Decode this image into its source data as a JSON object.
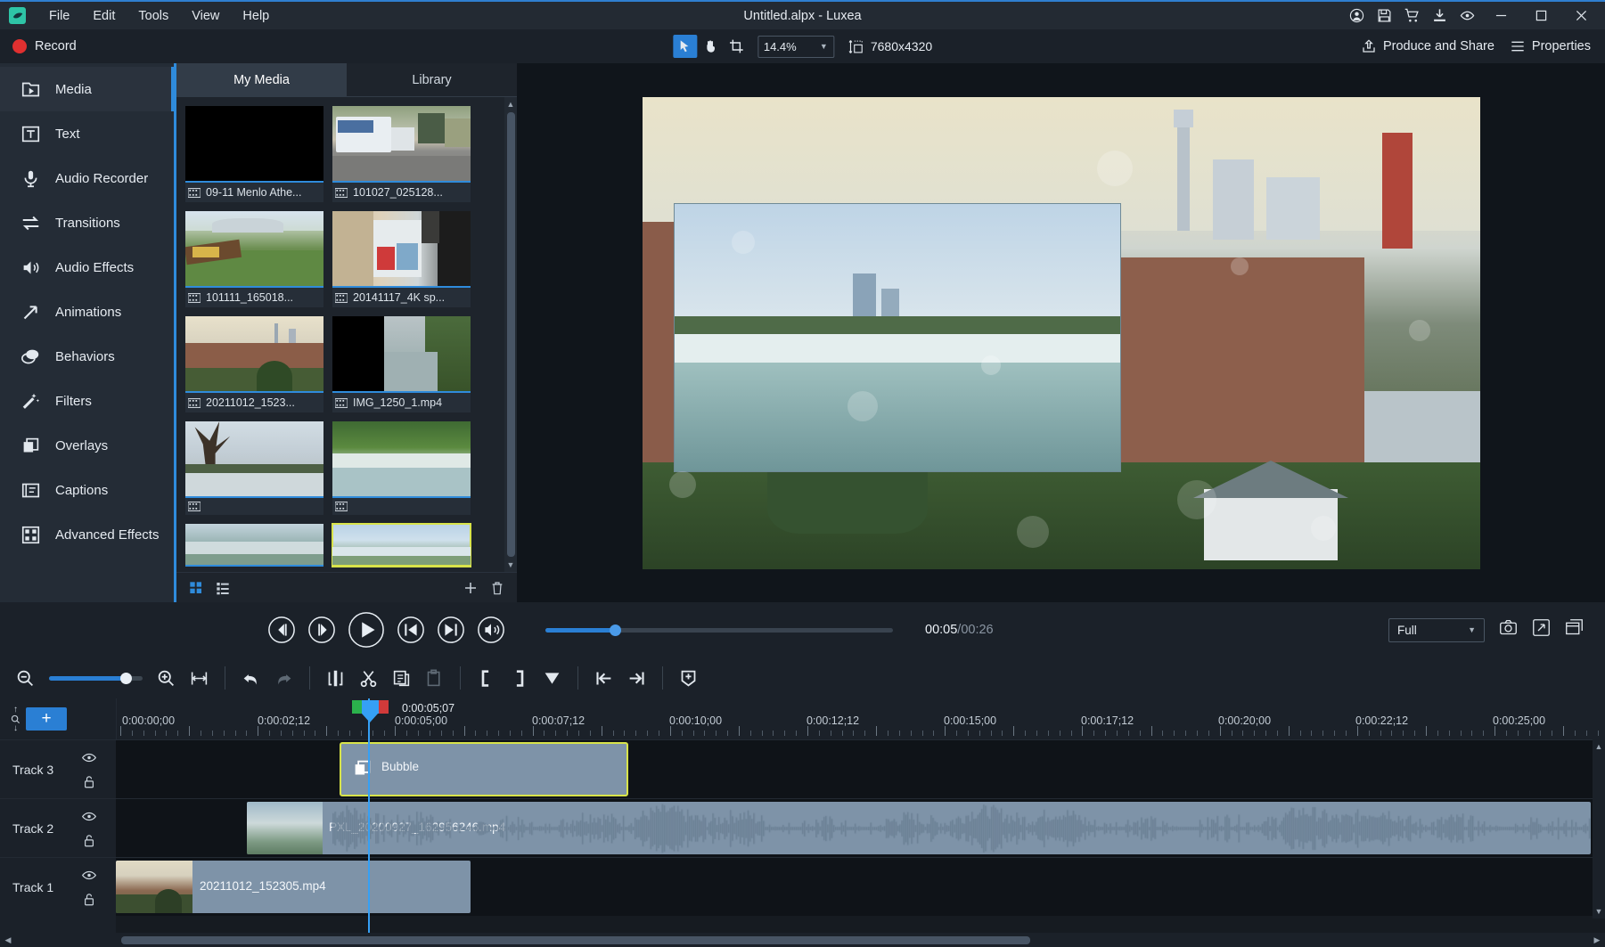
{
  "window": {
    "title": "Untitled.alpx - Luxea",
    "menus": [
      "File",
      "Edit",
      "Tools",
      "View",
      "Help"
    ],
    "titlebar_icons": [
      "account-icon",
      "save-icon",
      "cart-icon",
      "download-icon",
      "eye-icon"
    ],
    "controls": [
      "minimize",
      "maximize",
      "close"
    ]
  },
  "toolbar": {
    "record_label": "Record",
    "tools": [
      {
        "name": "select-tool",
        "active": true
      },
      {
        "name": "pan-tool",
        "active": false
      },
      {
        "name": "crop-tool",
        "active": false
      }
    ],
    "zoom_value": "14.4%",
    "dimensions": "7680x4320",
    "produce_label": "Produce and Share",
    "properties_label": "Properties"
  },
  "sidebar": {
    "items": [
      {
        "label": "Media",
        "icon": "media-folder-icon",
        "active": true
      },
      {
        "label": "Text",
        "icon": "text-icon",
        "active": false
      },
      {
        "label": "Audio Recorder",
        "icon": "microphone-icon",
        "active": false
      },
      {
        "label": "Transitions",
        "icon": "transitions-icon",
        "active": false
      },
      {
        "label": "Audio Effects",
        "icon": "speaker-icon",
        "active": false
      },
      {
        "label": "Animations",
        "icon": "arrow-up-right-icon",
        "active": false
      },
      {
        "label": "Behaviors",
        "icon": "behaviors-icon",
        "active": false
      },
      {
        "label": "Filters",
        "icon": "magic-wand-icon",
        "active": false
      },
      {
        "label": "Overlays",
        "icon": "layers-icon",
        "active": false
      },
      {
        "label": "Captions",
        "icon": "captions-icon",
        "active": false
      },
      {
        "label": "Advanced Effects",
        "icon": "advanced-effects-icon",
        "active": false
      }
    ]
  },
  "media_panel": {
    "tabs": [
      {
        "label": "My Media",
        "active": true
      },
      {
        "label": "Library",
        "active": false
      }
    ],
    "items": [
      {
        "label": "09-11 Menlo Athe...",
        "selected": false
      },
      {
        "label": "101027_025128...",
        "selected": false
      },
      {
        "label": "101111_165018...",
        "selected": false
      },
      {
        "label": "20141117_4K sp...",
        "selected": false
      },
      {
        "label": "20211012_1523...",
        "selected": false
      },
      {
        "label": "IMG_1250_1.mp4",
        "selected": false
      },
      {
        "label": "",
        "selected": false
      },
      {
        "label": "",
        "selected": true
      }
    ],
    "footer_icons": [
      "grid-view-icon",
      "list-view-icon",
      "add-media-icon",
      "delete-media-icon"
    ]
  },
  "playback": {
    "buttons": [
      "step-back-icon",
      "step-forward-icon",
      "play-icon",
      "jump-start-icon",
      "jump-end-icon",
      "volume-icon"
    ],
    "current_time": "00:05",
    "total_time": "/00:26",
    "quality": "Full",
    "right_icons": [
      "snapshot-icon",
      "fullscreen-icon",
      "detach-window-icon"
    ]
  },
  "timeline_toolbar": {
    "icons": [
      "zoom-out-icon",
      "zoom-slider",
      "zoom-in-icon",
      "fit-timeline-icon",
      "undo-icon",
      "redo-icon",
      "split-icon",
      "cut-icon",
      "copy-icon",
      "paste-icon",
      "mark-in-icon",
      "mark-out-icon",
      "marker-icon",
      "prev-edit-icon",
      "next-edit-icon",
      "add-marker-icon"
    ]
  },
  "timeline": {
    "add_track_label": "+",
    "playhead_time": "0:00:05;07",
    "ruler_labels": [
      "0:00:00;00",
      "0:00:02;12",
      "0:00:05;00",
      "0:00:07;12",
      "0:00:10;00",
      "0:00:12;12",
      "0:00:15;00",
      "0:00:17;12",
      "0:00:20;00",
      "0:00:22;12",
      "0:00:25;00"
    ],
    "tracks": [
      {
        "name": "Track 3",
        "clip": "Bubble",
        "type": "effect"
      },
      {
        "name": "Track 2",
        "clip": "PXL_20200927_162956246.mp4",
        "type": "video-audio"
      },
      {
        "name": "Track 1",
        "clip": "20211012_152305.mp4",
        "type": "video"
      }
    ],
    "track_icons": [
      "eye-icon",
      "lock-icon"
    ]
  },
  "colors": {
    "accent": "#2a7fd4",
    "selection": "#d8e34a",
    "record": "#e03030",
    "playhead": "#35a0f5"
  }
}
